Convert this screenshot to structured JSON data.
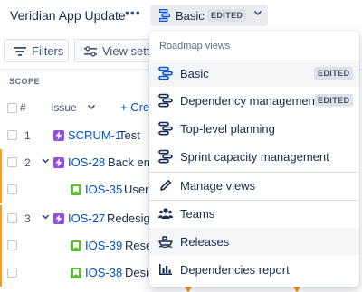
{
  "header": {
    "project_title": "Veridian App Update",
    "more_label": "•••",
    "view_selector": {
      "label": "Basic",
      "badge": "EDITED"
    }
  },
  "toolbar": {
    "filters_label": "Filters",
    "view_settings_label": "View setti"
  },
  "table": {
    "scope_label": "SCOPE",
    "columns": {
      "hash": "#",
      "issue": "Issue",
      "create": "+ Cre"
    },
    "rows": [
      {
        "rank": "1",
        "key": "SCRUM-1",
        "summary": "Test",
        "type": "epic",
        "expandable": false
      },
      {
        "rank": "2",
        "key": "IOS-28",
        "summary": "Back end",
        "type": "epic",
        "expandable": true
      },
      {
        "rank": "",
        "key": "IOS-35",
        "summary": "User",
        "type": "story",
        "expandable": false
      },
      {
        "rank": "3",
        "key": "IOS-27",
        "summary": "Redesign",
        "type": "epic",
        "expandable": true
      },
      {
        "rank": "",
        "key": "IOS-39",
        "summary": "Resea",
        "type": "story",
        "expandable": false
      },
      {
        "rank": "",
        "key": "IOS-38",
        "summary": "Desig",
        "type": "story",
        "expandable": false
      }
    ]
  },
  "dropdown": {
    "section_title": "Roadmap views",
    "views": [
      {
        "label": "Basic",
        "badge": "EDITED",
        "icon": "roadmap-view-icon-blue",
        "selected": true
      },
      {
        "label": "Dependency management",
        "badge": "EDITED",
        "icon": "roadmap-view-icon",
        "selected": false
      },
      {
        "label": "Top-level planning",
        "badge": "",
        "icon": "roadmap-view-icon",
        "selected": false
      },
      {
        "label": "Sprint capacity management",
        "badge": "",
        "icon": "roadmap-view-icon",
        "selected": false
      }
    ],
    "manage_views_label": "Manage views",
    "teams_label": "Teams",
    "releases_label": "Releases",
    "dependencies_report_label": "Dependencies report"
  },
  "colors": {
    "accent_blue": "#0052cc",
    "epic_purple": "#904ee2",
    "story_green": "#63ba3c",
    "highlight_orange": "#ff991f",
    "lozenge_bg": "#dfe1e6"
  }
}
